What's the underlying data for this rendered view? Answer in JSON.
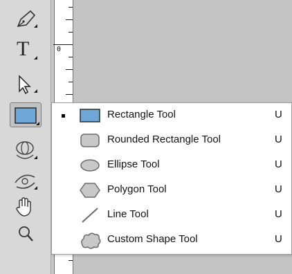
{
  "ruler": {
    "zero_label": "0"
  },
  "toolbar": {
    "tools": [
      {
        "name": "pen-tool",
        "icon": "pen-icon"
      },
      {
        "name": "type-tool",
        "icon": "type-icon",
        "glyph": "T"
      },
      {
        "name": "path-selection-tool",
        "icon": "arrow-icon"
      },
      {
        "name": "shape-tool",
        "icon": "rectangle-icon",
        "active": true
      },
      {
        "name": "3d-rotate-tool",
        "icon": "3d-rotate-icon"
      },
      {
        "name": "3d-orbit-tool",
        "icon": "3d-orbit-icon"
      },
      {
        "name": "hand-tool",
        "icon": "hand-icon"
      },
      {
        "name": "zoom-tool",
        "icon": "magnifier-icon"
      }
    ]
  },
  "menu": {
    "items": [
      {
        "label": "Rectangle Tool",
        "shortcut": "U",
        "icon": "rectangle-icon",
        "selected": true
      },
      {
        "label": "Rounded Rectangle Tool",
        "shortcut": "U",
        "icon": "rounded-rectangle-icon"
      },
      {
        "label": "Ellipse Tool",
        "shortcut": "U",
        "icon": "ellipse-icon"
      },
      {
        "label": "Polygon Tool",
        "shortcut": "U",
        "icon": "polygon-icon"
      },
      {
        "label": "Line Tool",
        "shortcut": "U",
        "icon": "line-icon"
      },
      {
        "label": "Custom Shape Tool",
        "shortcut": "U",
        "icon": "custom-shape-icon"
      }
    ]
  },
  "colors": {
    "rect_fill": "#6fa8d8",
    "shape_fill": "#c8c8c8",
    "shape_stroke": "#6a6a6a"
  }
}
